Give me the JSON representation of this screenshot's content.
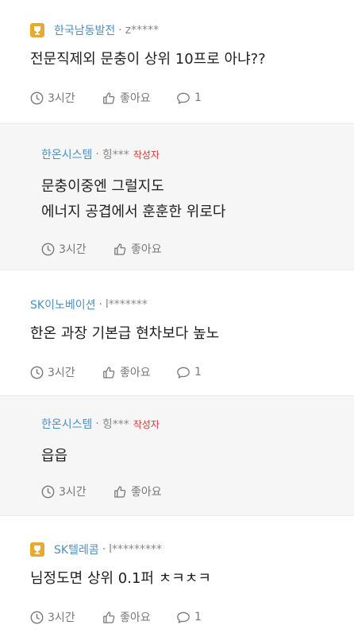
{
  "comments": [
    {
      "company": "한국남동발전",
      "user": "z*****",
      "company_icon": "trophy-icon",
      "lines": [
        "전문직제외 문충이 상위 10프로 아냐??"
      ],
      "time": "3시간",
      "like_label": "좋아요",
      "reply_count": "1"
    },
    {
      "company": "한온시스템",
      "user": "힝***",
      "author_badge": "작성자",
      "lines": [
        "문충이중엔 그럴지도",
        "에너지 공겹에서 훈훈한 위로다"
      ],
      "time": "3시간",
      "like_label": "좋아요"
    },
    {
      "company": "SK이노베이션",
      "user": "l*******",
      "lines": [
        "한온 과장 기본급 현차보다 높노"
      ],
      "time": "3시간",
      "like_label": "좋아요",
      "reply_count": "1"
    },
    {
      "company": "한온시스템",
      "user": "힝***",
      "author_badge": "작성자",
      "lines": [
        "읍읍"
      ],
      "time": "3시간",
      "like_label": "좋아요"
    },
    {
      "company": "SK텔레콤",
      "user": "l*********",
      "company_icon": "trophy-icon",
      "lines": [
        "님정도면 상위 0.1퍼 ㅊㅋㅊㅋ"
      ],
      "time": "3시간",
      "like_label": "좋아요",
      "reply_count": "1"
    }
  ],
  "colors": {
    "company": "#4d8fc5",
    "author_badge": "#e0332f",
    "reply_background": "#f6f6f6",
    "trophy": "#e8a92c"
  }
}
